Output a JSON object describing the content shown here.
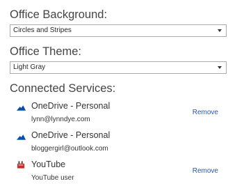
{
  "office_background": {
    "label": "Office Background:",
    "selected": "Circles and Stripes"
  },
  "office_theme": {
    "label": "Office Theme:",
    "selected": "Light Gray"
  },
  "connected_services": {
    "label": "Connected Services:",
    "items": [
      {
        "name": "OneDrive - Personal",
        "account": "lynn@lynndye.com",
        "action": "Remove",
        "icon": "onedrive-icon"
      },
      {
        "name": "OneDrive - Personal",
        "account": "bloggergirl@outlook.com",
        "action": "",
        "icon": "onedrive-icon"
      },
      {
        "name": "YouTube",
        "account": "YouTube user",
        "action": "Remove",
        "icon": "youtube-icon"
      }
    ]
  },
  "colors": {
    "link": "#2b579a",
    "onedrive": "#0a4ea3",
    "youtube": "#c4302b"
  }
}
